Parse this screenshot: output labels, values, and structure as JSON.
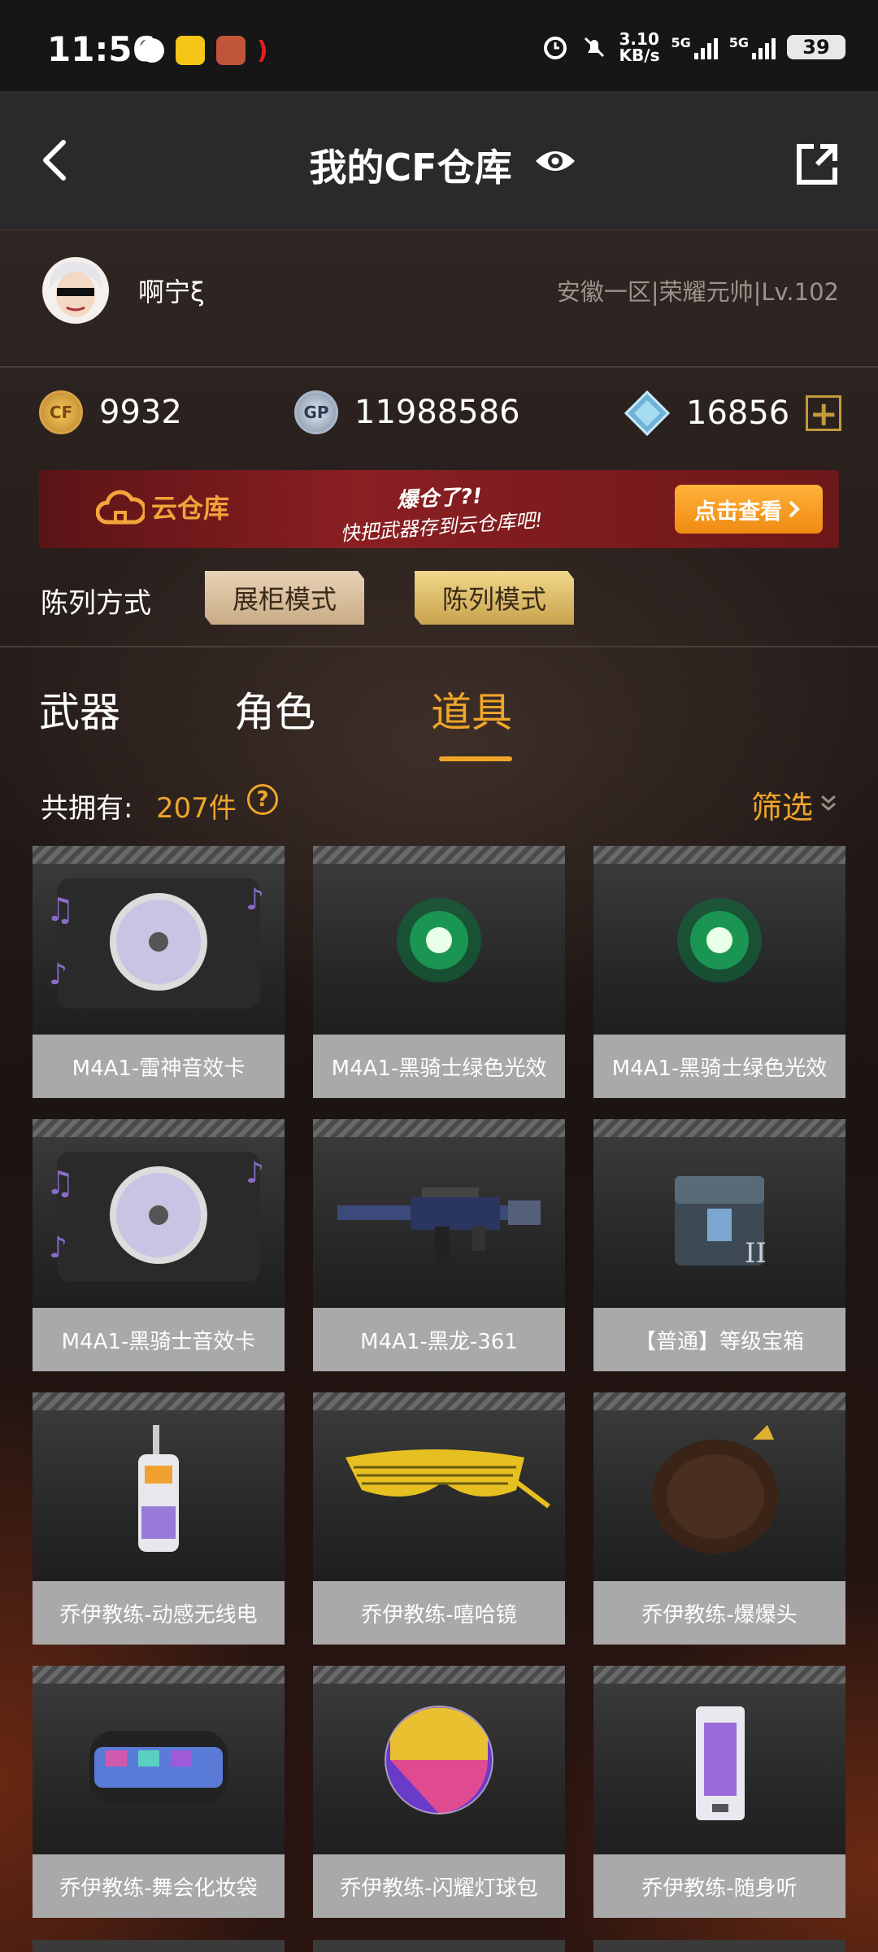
{
  "status_bar": {
    "time": "11:56",
    "net_speed_value": "3.10",
    "net_speed_unit": "KB/s",
    "sim1": "5G",
    "sim2": "5G",
    "battery": "39"
  },
  "header": {
    "title": "我的CF仓库"
  },
  "profile": {
    "name": "啊宁ξ",
    "server_info": "安徽一区|荣耀元帅|Lv.102"
  },
  "currency": {
    "cf_points": "9932",
    "gp": "11988586",
    "gp_icon_text": "GP",
    "diamonds": "16856"
  },
  "banner": {
    "logo_text": "云仓库",
    "line1": "爆仓了?!",
    "line2": "快把武器存到云仓库吧!",
    "button": "点击查看"
  },
  "display_mode": {
    "label": "陈列方式",
    "options": [
      "展柜模式",
      "陈列模式"
    ],
    "selected": "陈列模式"
  },
  "tabs": [
    "武器",
    "角色",
    "道具"
  ],
  "active_tab": "道具",
  "inventory": {
    "count_label": "共拥有:",
    "count_value": "207件",
    "filter_label": "筛选"
  },
  "items": [
    {
      "name": "M4A1-雷神音效卡",
      "icon": "music-disc-icon"
    },
    {
      "name": "M4A1-黑骑士绿色光效",
      "icon": "green-glow-icon"
    },
    {
      "name": "M4A1-黑骑士绿色光效",
      "icon": "green-glow-icon"
    },
    {
      "name": "M4A1-黑骑士音效卡",
      "icon": "music-disc-icon"
    },
    {
      "name": "M4A1-黑龙-361",
      "icon": "rifle-icon"
    },
    {
      "name": "【普通】等级宝箱",
      "icon": "treasure-chest-icon"
    },
    {
      "name": "乔伊教练-动感无线电",
      "icon": "walkie-talkie-icon"
    },
    {
      "name": "乔伊教练-嘻哈镜",
      "icon": "shutter-glasses-icon"
    },
    {
      "name": "乔伊教练-爆爆头",
      "icon": "afro-wig-icon"
    },
    {
      "name": "乔伊教练-舞会化妆袋",
      "icon": "makeup-bag-icon"
    },
    {
      "name": "乔伊教练-闪耀灯球包",
      "icon": "disco-ball-icon"
    },
    {
      "name": "乔伊教练-随身听",
      "icon": "cassette-icon"
    }
  ],
  "colors": {
    "accent": "#f0a52a",
    "nav_bg": "#2a2a2c",
    "card_label_bg": "#a9a9a9"
  }
}
